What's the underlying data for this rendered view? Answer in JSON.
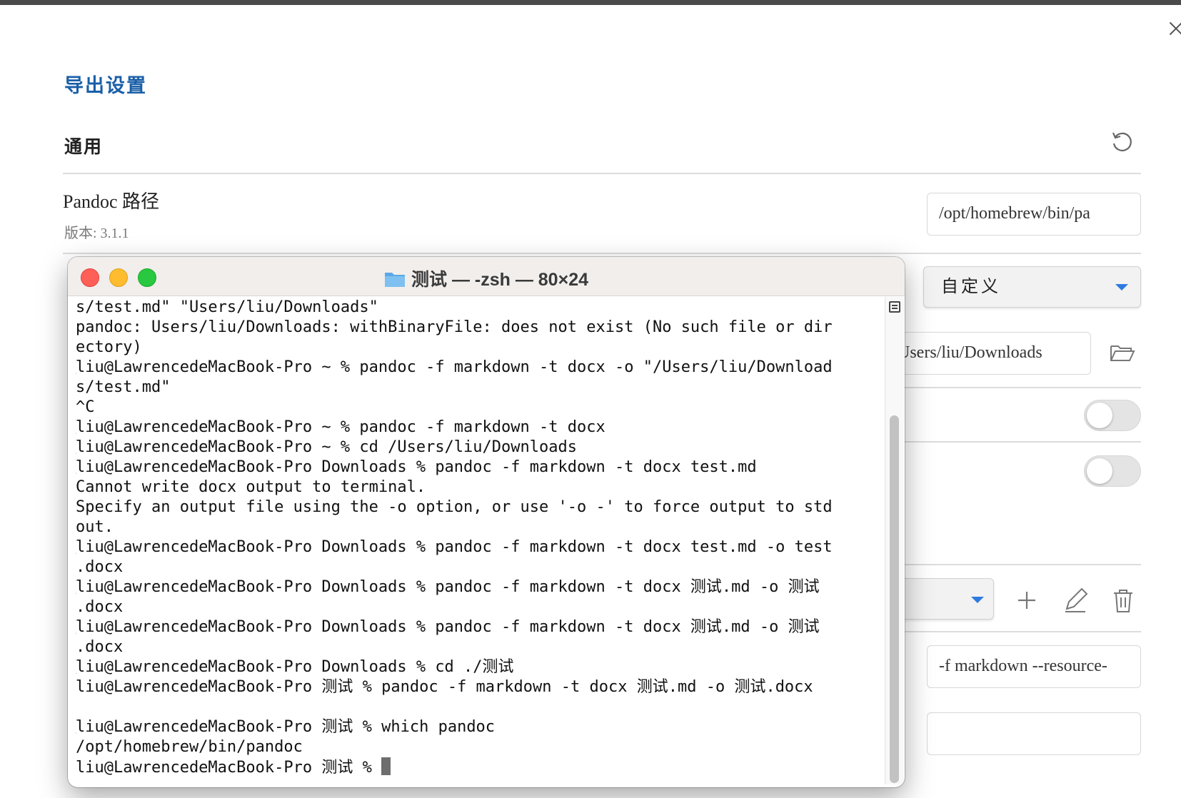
{
  "settings": {
    "title": "导出设置",
    "section_general": "通用",
    "pandoc_path_label": "Pandoc 路径",
    "pandoc_version": "版本: 3.1.1",
    "pandoc_path_value": "/opt/homebrew/bin/pa",
    "profile_select_value": "自定义",
    "output_dir_value": "Users/liu/Downloads",
    "args_value": "-f markdown --resource-",
    "empty_field_value": ""
  },
  "icons": {
    "reset": "reset-icon",
    "folder": "folder-open-icon",
    "add": "plus-icon",
    "edit": "pencil-icon",
    "delete": "trash-icon",
    "close": "close-icon"
  },
  "terminal": {
    "title": "测试 — -zsh — 80×24",
    "lines": [
      {
        "text": "s/test.md\" \"Users/liu/Downloads\"",
        "l": false,
        "r": false
      },
      {
        "text": "pandoc: Users/liu/Downloads: withBinaryFile: does not exist (No such file or dir",
        "l": false,
        "r": false
      },
      {
        "text": "ectory)",
        "l": false,
        "r": false
      },
      {
        "text": "liu@LawrencedeMacBook-Pro ~ % pandoc -f markdown -t docx -o \"/Users/liu/Download",
        "l": true,
        "r": true
      },
      {
        "text": "s/test.md\"",
        "l": false,
        "r": false
      },
      {
        "text": "^C",
        "l": false,
        "r": false
      },
      {
        "text": "liu@LawrencedeMacBook-Pro ~ % pandoc -f markdown -t docx",
        "l": true,
        "r": true
      },
      {
        "text": "liu@LawrencedeMacBook-Pro ~ % cd /Users/liu/Downloads",
        "l": true,
        "r": true
      },
      {
        "text": "liu@LawrencedeMacBook-Pro Downloads % pandoc -f markdown -t docx test.md",
        "l": true,
        "r": true
      },
      {
        "text": "Cannot write docx output to terminal.",
        "l": false,
        "r": false
      },
      {
        "text": "Specify an output file using the -o option, or use '-o -' to force output to std",
        "l": false,
        "r": false
      },
      {
        "text": "out.",
        "l": false,
        "r": false
      },
      {
        "text": "liu@LawrencedeMacBook-Pro Downloads % pandoc -f markdown -t docx test.md -o test",
        "l": true,
        "r": true
      },
      {
        "text": ".docx",
        "l": false,
        "r": false
      },
      {
        "text": "liu@LawrencedeMacBook-Pro Downloads % pandoc -f markdown -t docx 测试.md -o 测试",
        "l": true,
        "r": true
      },
      {
        "text": ".docx",
        "l": false,
        "r": false
      },
      {
        "text": "liu@LawrencedeMacBook-Pro Downloads % pandoc -f markdown -t docx 测试.md -o 测试",
        "l": true,
        "r": true
      },
      {
        "text": ".docx",
        "l": false,
        "r": false
      },
      {
        "text": "liu@LawrencedeMacBook-Pro Downloads % cd ./测试",
        "l": true,
        "r": true
      },
      {
        "text": "liu@LawrencedeMacBook-Pro 测试 % pandoc -f markdown -t docx 测试.md -o 测试.docx",
        "l": false,
        "r": false
      },
      {
        "text": "",
        "l": false,
        "r": false
      },
      {
        "text": "liu@LawrencedeMacBook-Pro 测试 % which pandoc",
        "l": true,
        "r": true
      },
      {
        "text": "/opt/homebrew/bin/pandoc",
        "l": false,
        "r": false
      },
      {
        "text": "liu@LawrencedeMacBook-Pro 测试 % ",
        "l": false,
        "r": false,
        "cursor": true
      }
    ]
  }
}
